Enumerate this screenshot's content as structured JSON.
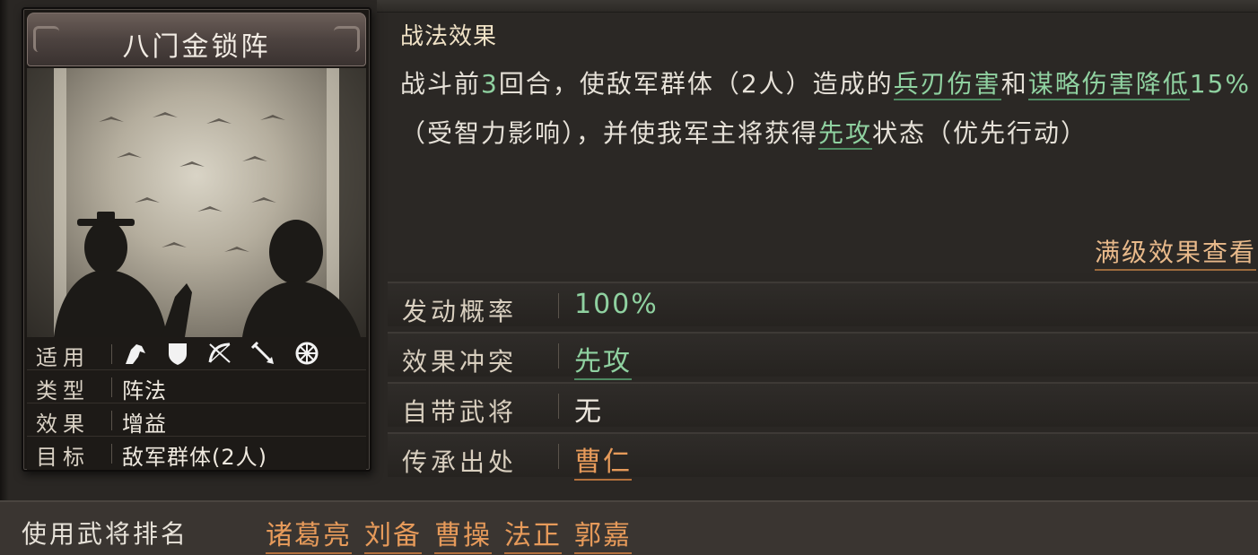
{
  "card": {
    "name": "八门金锁阵",
    "info": [
      {
        "label": "适用",
        "icons": [
          "cavalry-icon",
          "shield-icon",
          "bow-icon",
          "spear-icon",
          "wheel-icon"
        ]
      },
      {
        "label": "类型",
        "value": "阵法"
      },
      {
        "label": "效果",
        "value": "增益"
      },
      {
        "label": "目标",
        "value": "敌军群体(2人)"
      }
    ]
  },
  "effect": {
    "header": "战法效果",
    "seg1": "战斗前",
    "num_rounds": "3",
    "seg2": "回合，使敌军群体（2人）造成的",
    "term_weapon": "兵刃伤害",
    "seg3": "和",
    "term_strategy": "谋略伤害降低",
    "percent": "15%",
    "seg4": "（受智力影响），并使我军主将获得",
    "term_first": "先攻",
    "seg5": "状态（优先行动）",
    "full_level_link": "满级效果查看"
  },
  "attributes": {
    "trigger_rate": {
      "label": "发动概率",
      "value": "100%"
    },
    "conflict": {
      "label": "效果冲突",
      "value": "先攻"
    },
    "innate_general": {
      "label": "自带武将",
      "value": "无"
    },
    "inherit_source": {
      "label": "传承出处",
      "value": "曹仁"
    }
  },
  "ranking": {
    "label": "使用武将排名",
    "generals": [
      "诸葛亮",
      "刘备",
      "曹操",
      "法正",
      "郭嘉"
    ]
  },
  "colors": {
    "highlight_green": "#8fd1a0",
    "highlight_orange": "#e69a5a",
    "link_orange": "#e8b98a"
  }
}
